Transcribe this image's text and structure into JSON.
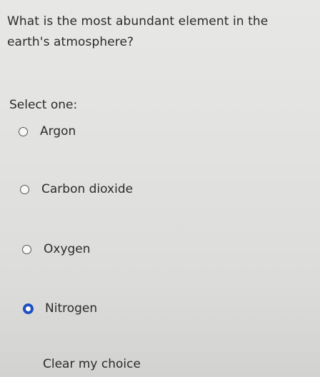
{
  "question": {
    "text": "What is the most abundant element in the earth's atmosphere?",
    "instruction": "Select one:"
  },
  "options": [
    {
      "label": "Argon",
      "selected": false
    },
    {
      "label": "Carbon dioxide",
      "selected": false
    },
    {
      "label": "Oxygen",
      "selected": false
    },
    {
      "label": "Nitrogen",
      "selected": true
    }
  ],
  "clear_choice": {
    "label": "Clear my choice"
  },
  "colors": {
    "selected_radio": "#1f4fc4",
    "text": "#2b2b2b"
  }
}
